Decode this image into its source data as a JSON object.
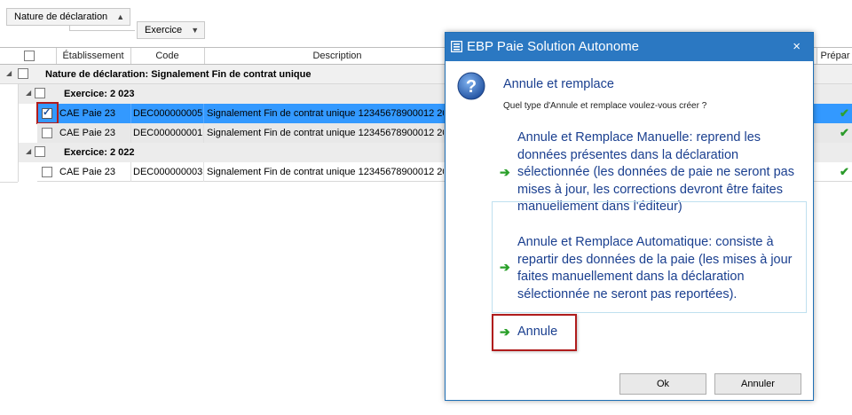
{
  "groupby": {
    "nature_label": "Nature de déclaration",
    "exercice_label": "Exercice"
  },
  "grid": {
    "columns": [
      "Établissement",
      "Code",
      "Description",
      "Prépar"
    ],
    "group_nature": "Nature de déclaration: Signalement Fin de contrat unique",
    "groups": [
      {
        "label": "Exercice: 2 023"
      },
      {
        "label": "Exercice: 2 022"
      }
    ],
    "rows": [
      {
        "etab": "CAE Paie 23",
        "code": "DEC000000005",
        "desc": "Signalement Fin de contrat unique 12345678900012 20",
        "checked": true
      },
      {
        "etab": "CAE Paie 23",
        "code": "DEC000000001",
        "desc": "Signalement Fin de contrat unique 12345678900012 20",
        "checked": false
      },
      {
        "etab": "CAE Paie 23",
        "code": "DEC000000003",
        "desc": "Signalement Fin de contrat unique 12345678900012 20",
        "checked": false
      }
    ]
  },
  "dialog": {
    "title": "EBP Paie Solution Autonome",
    "close": "×",
    "heading": "Annule et remplace",
    "subtitle": "Quel type d'Annule et remplace voulez-vous créer ?",
    "option_manual": "Annule et Remplace Manuelle: reprend les données présentes dans la déclaration sélectionnée (les données de paie ne seront pas mises à jour, les corrections devront être faites manuellement dans l'éditeur)",
    "option_auto": "Annule et Remplace Automatique: consiste à repartir des données de la paie (les mises à jour faites manuellement dans la déclaration sélectionnée ne seront pas reportées).",
    "option_annule": "Annule",
    "ok": "Ok",
    "cancel": "Annuler"
  },
  "colors": {
    "title_bar": "#2b78c2",
    "selected_row": "#3399ff",
    "link_text": "#1a3f8f",
    "arrow_green": "#2aa02a",
    "highlight_red": "#b01c1c"
  }
}
